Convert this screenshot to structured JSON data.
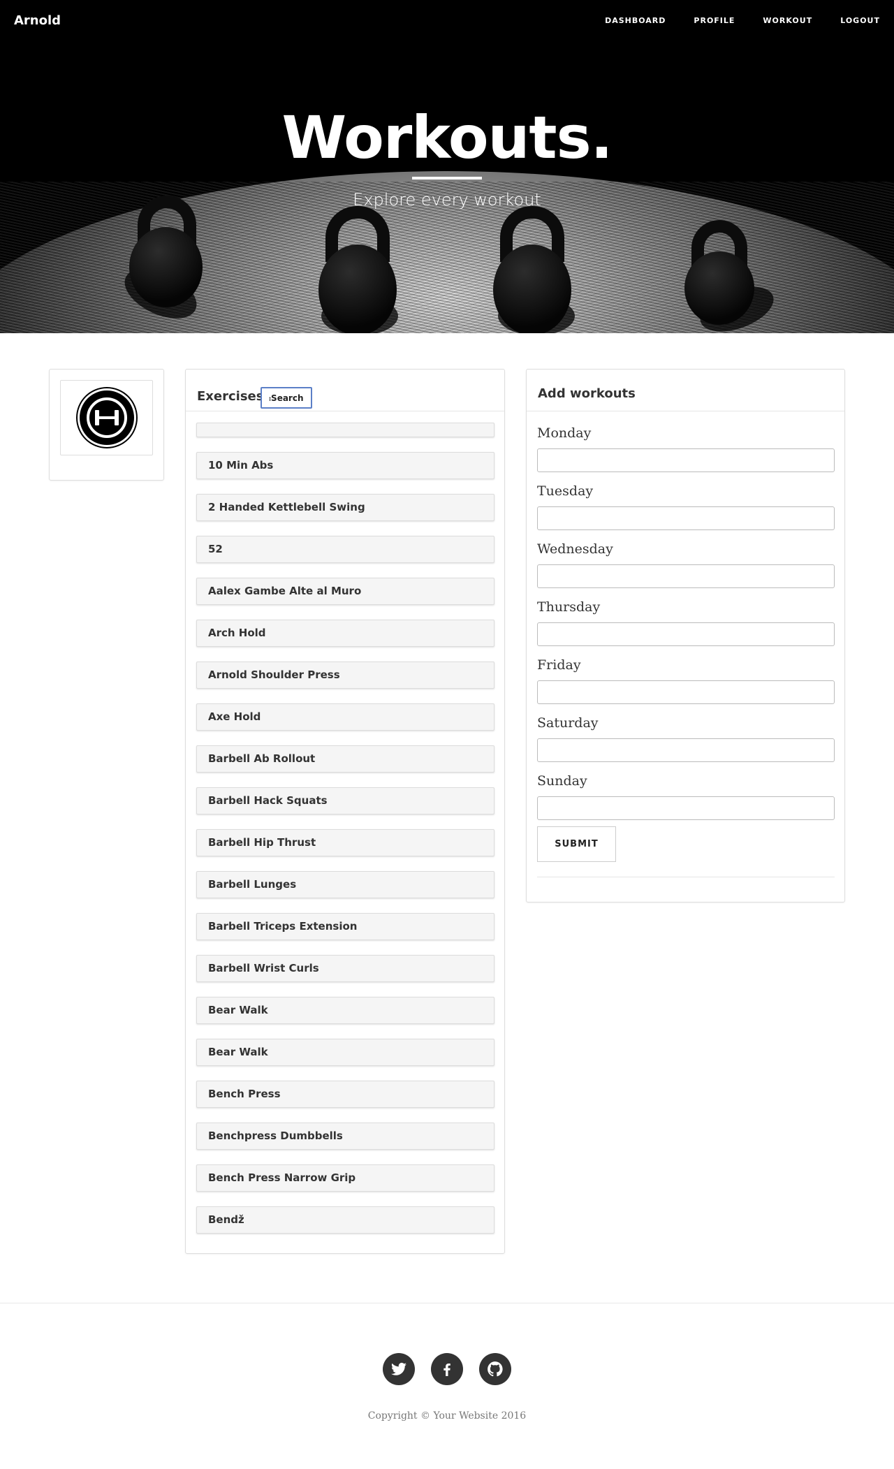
{
  "nav": {
    "brand": "Arnold",
    "links": [
      "DASHBOARD",
      "PROFILE",
      "WORKOUT",
      "LOGOUT"
    ]
  },
  "hero": {
    "title": "Workouts.",
    "subtitle": "Explore every workout"
  },
  "exercises": {
    "title": "Exercises",
    "search_label": "Search",
    "items": [
      "",
      "10 Min Abs",
      "2 Handed Kettlebell Swing",
      "52",
      "Aalex Gambe Alte al Muro",
      "Arch Hold",
      "Arnold Shoulder Press",
      "Axe Hold",
      "Barbell Ab Rollout",
      "Barbell Hack Squats",
      "Barbell Hip Thrust",
      "Barbell Lunges",
      "Barbell Triceps Extension",
      "Barbell Wrist Curls",
      "Bear Walk",
      "Bear Walk",
      "Bench Press",
      "Benchpress Dumbbells",
      "Bench Press Narrow Grip",
      "Bendž"
    ]
  },
  "add_workouts": {
    "title": "Add workouts",
    "days": [
      "Monday",
      "Tuesday",
      "Wednesday",
      "Thursday",
      "Friday",
      "Saturday",
      "Sunday"
    ],
    "values": [
      "",
      "",
      "",
      "",
      "",
      "",
      ""
    ],
    "submit_label": "SUBMIT"
  },
  "footer": {
    "social": [
      "twitter-icon",
      "facebook-icon",
      "github-icon"
    ],
    "copyright": "Copyright © Your Website 2016"
  },
  "colors": {
    "hero_bg": "#000000",
    "social_bg": "#333333",
    "search_border": "#5b7fc7"
  }
}
